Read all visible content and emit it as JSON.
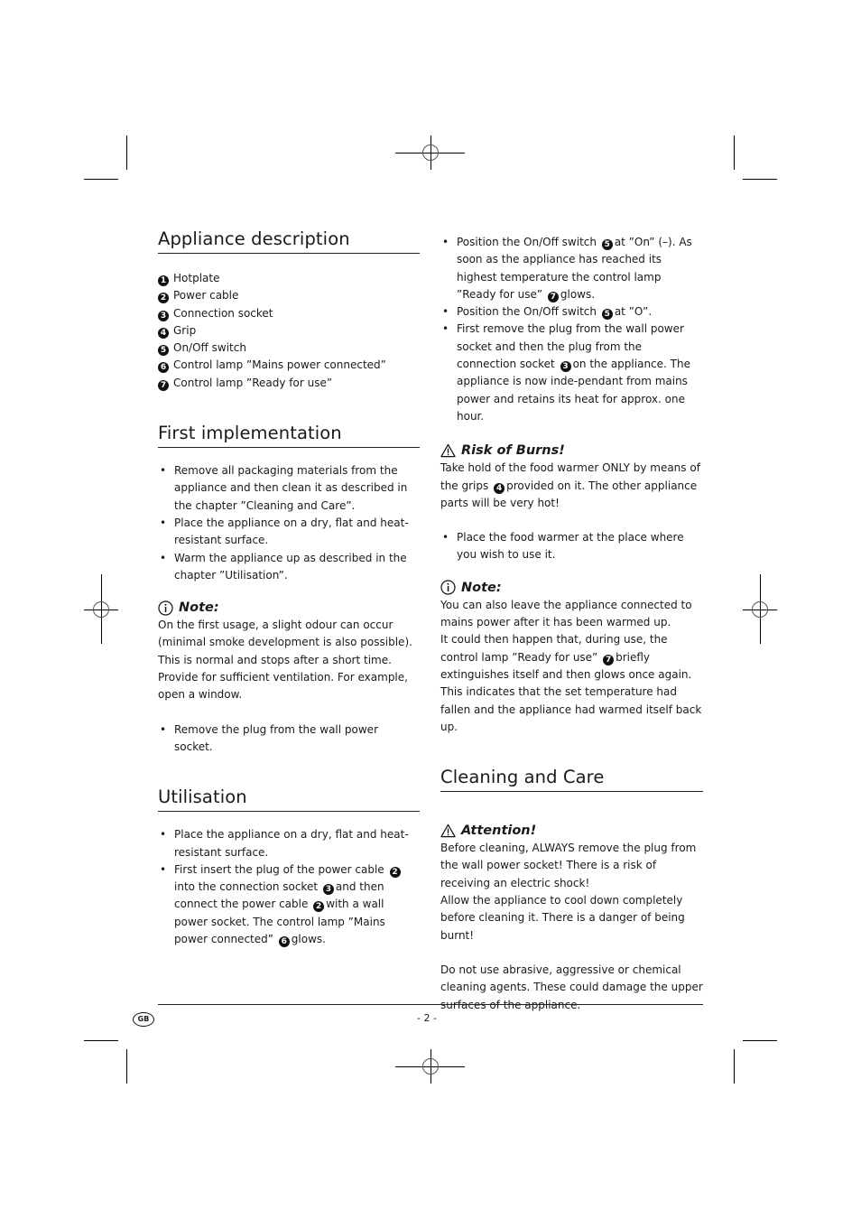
{
  "appliance_description": {
    "title": "Appliance description",
    "items": [
      {
        "num": "1",
        "label": "Hotplate"
      },
      {
        "num": "2",
        "label": "Power cable"
      },
      {
        "num": "3",
        "label": "Connection socket"
      },
      {
        "num": "4",
        "label": "Grip"
      },
      {
        "num": "5",
        "label": "On/Off switch"
      },
      {
        "num": "6",
        "label": "Control lamp ”Mains power connected”"
      },
      {
        "num": "7",
        "label": "Control lamp ”Ready for use”"
      }
    ]
  },
  "first_implementation": {
    "title": "First implementation",
    "bullets": [
      "Remove all packaging materials from the appliance and then clean it as described in the chapter ”Cleaning and Care”.",
      "Place the appliance on a dry, flat and heat-resistant surface.",
      "Warm the appliance up as described in the chapter ”Utilisation”."
    ],
    "note_title": "Note:",
    "note_text": "On the first usage, a slight odour can occur (minimal smoke development is also possible). This is normal and stops after a short time. Provide for sufficient ventilation. For example, open a window.",
    "final_bullet": "Remove the plug from the wall power socket."
  },
  "utilisation": {
    "title": "Utilisation",
    "bullet1": "Place the appliance on a dry, flat and heat-resistant surface.",
    "bullet2": {
      "a": "First insert the plug of the power cable",
      "n1": "2",
      "b": "into the connection socket",
      "n2": "3",
      "c": "and then connect the power cable",
      "n3": "2",
      "d": "with a wall power socket. The control lamp ”Mains power connected”",
      "n4": "6",
      "e": "glows."
    }
  },
  "right_column": {
    "bullet1": {
      "a": "Position the On/Off switch",
      "n1": "5",
      "b": "at ”On” (–). As soon as the appliance has reached its highest temperature the control lamp ”Ready for use”",
      "n2": "7",
      "c": "glows."
    },
    "bullet2": {
      "a": "Position the On/Off switch",
      "n1": "5",
      "b": "at ”O”."
    },
    "bullet3": {
      "a": "First remove the plug from the wall power socket and then the plug from the connection socket",
      "n1": "3",
      "b": "on the appliance. The appliance is now inde-pendant from mains power and retains its heat for approx. one hour."
    },
    "risk_title": "Risk of Burns!",
    "risk_text": {
      "a": "Take hold of the food warmer ONLY by means of the grips",
      "n1": "4",
      "b": "provided on it. The other appliance parts will be very hot!"
    },
    "bullet4": "Place the food warmer at the place where you wish to use it.",
    "note_title": "Note:",
    "note_text": {
      "a": "You can also leave the appliance connected to mains power after it has been warmed up.",
      "b": " It could then happen that, during use, the control lamp ”Ready for use”",
      "n1": "7",
      "c": "briefly extinguishes itself and then glows once again. This indicates that the set temperature had fallen and the appliance had warmed itself back up."
    }
  },
  "cleaning_and_care": {
    "title": "Cleaning and Care",
    "attention_title": "Attention!",
    "attention_text1": "Before cleaning, ALWAYS remove the plug from the wall power socket! There is a risk of receiving an electric shock!",
    "attention_text2": "Allow the appliance to cool down completely before cleaning it. There is a danger of being burnt!",
    "text": "Do not use abrasive, aggressive or chemical cleaning agents. These could damage the upper surfaces of the appliance."
  },
  "footer": {
    "language_badge": "GB",
    "page_number": "- 2 -"
  }
}
